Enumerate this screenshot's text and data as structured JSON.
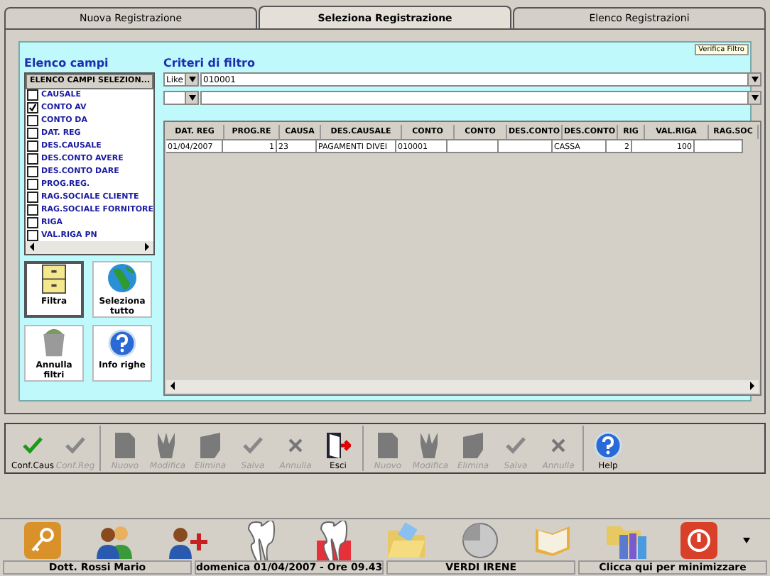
{
  "tabs": [
    {
      "label": "Nuova Registrazione",
      "selected": false
    },
    {
      "label": "Seleziona Registrazione",
      "selected": true
    },
    {
      "label": "Elenco Registrazioni",
      "selected": false
    }
  ],
  "verify_button": "Verifica Filtro",
  "fields_panel": {
    "title": "Elenco campi",
    "header": "ELENCO CAMPI SELEZION...",
    "items": [
      {
        "label": "CAUSALE",
        "checked": false
      },
      {
        "label": "CONTO AV",
        "checked": true
      },
      {
        "label": "CONTO DA",
        "checked": false
      },
      {
        "label": "DAT. REG",
        "checked": false
      },
      {
        "label": "DES.CAUSALE",
        "checked": false
      },
      {
        "label": "DES.CONTO AVERE",
        "checked": false
      },
      {
        "label": "DES.CONTO DARE",
        "checked": false
      },
      {
        "label": "PROG.REG.",
        "checked": false
      },
      {
        "label": "RAG.SOCIALE CLIENTE",
        "checked": false
      },
      {
        "label": "RAG.SOCIALE FORNITORE",
        "checked": false
      },
      {
        "label": "RIGA",
        "checked": false
      },
      {
        "label": "VAL.RIGA PN",
        "checked": false
      }
    ]
  },
  "action_buttons": [
    {
      "label": "Filtra",
      "kind": "filter"
    },
    {
      "label": "Seleziona tutto",
      "kind": "globe"
    },
    {
      "label": "Annulla filtri",
      "kind": "trash"
    },
    {
      "label": "Info righe",
      "kind": "help"
    }
  ],
  "filter": {
    "title": "Criteri di filtro",
    "rows": [
      {
        "operator": "Like",
        "value": "010001"
      },
      {
        "operator": "",
        "value": ""
      }
    ]
  },
  "table": {
    "columns": [
      "DAT. REG",
      "PROG.RE",
      "CAUSA",
      "DES.CAUSALE",
      "CONTO",
      "CONTO",
      "DES.CONTO",
      "DES.CONTO",
      "RIG",
      "VAL.RIGA",
      "RAG.SOC"
    ],
    "rows": [
      [
        "01/04/2007",
        "1",
        "23",
        "PAGAMENTI DIVEI",
        "010001",
        "",
        "",
        "CASSA",
        "2",
        "100",
        ""
      ]
    ]
  },
  "toolbar": [
    {
      "label": "Conf.Caus",
      "kind": "check",
      "disabled": false
    },
    {
      "label": "Conf.Reg",
      "kind": "check",
      "disabled": true
    },
    {
      "label": "Nuovo",
      "kind": "doc",
      "disabled": true
    },
    {
      "label": "Modifica",
      "kind": "edit",
      "disabled": true
    },
    {
      "label": "Elimina",
      "kind": "erase",
      "disabled": true
    },
    {
      "label": "Salva",
      "kind": "check",
      "disabled": true
    },
    {
      "label": "Annulla",
      "kind": "cross",
      "disabled": true
    },
    {
      "label": "Esci",
      "kind": "exit",
      "disabled": false
    },
    {
      "label": "Nuovo",
      "kind": "doc",
      "disabled": true
    },
    {
      "label": "Modifica",
      "kind": "edit",
      "disabled": true
    },
    {
      "label": "Elimina",
      "kind": "erase",
      "disabled": true
    },
    {
      "label": "Salva",
      "kind": "check",
      "disabled": true
    },
    {
      "label": "Annulla",
      "kind": "cross",
      "disabled": true
    },
    {
      "label": "Help",
      "kind": "help",
      "disabled": false
    }
  ],
  "taskbar": {
    "status": [
      "Dott. Rossi Mario",
      "domenica 01/04/2007 - Ore 09.43",
      "VERDI IRENE",
      "Clicca qui per minimizzare"
    ]
  }
}
